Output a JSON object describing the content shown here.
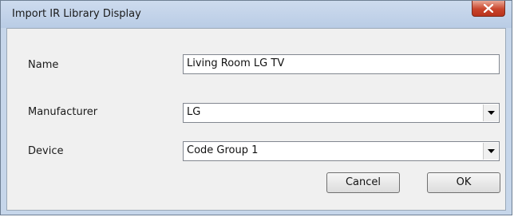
{
  "window": {
    "title": "Import IR Library Display"
  },
  "form": {
    "name_label": "Name",
    "name_value": "Living Room LG TV",
    "manufacturer_label": "Manufacturer",
    "manufacturer_value": "LG",
    "device_label": "Device",
    "device_value": "Code Group 1"
  },
  "buttons": {
    "cancel": "Cancel",
    "ok": "OK"
  },
  "icons": {
    "close": "close-icon",
    "dropdown": "chevron-down-icon"
  },
  "colors": {
    "close_button": "#c9452c",
    "titlebar": "#c6d6ea"
  }
}
